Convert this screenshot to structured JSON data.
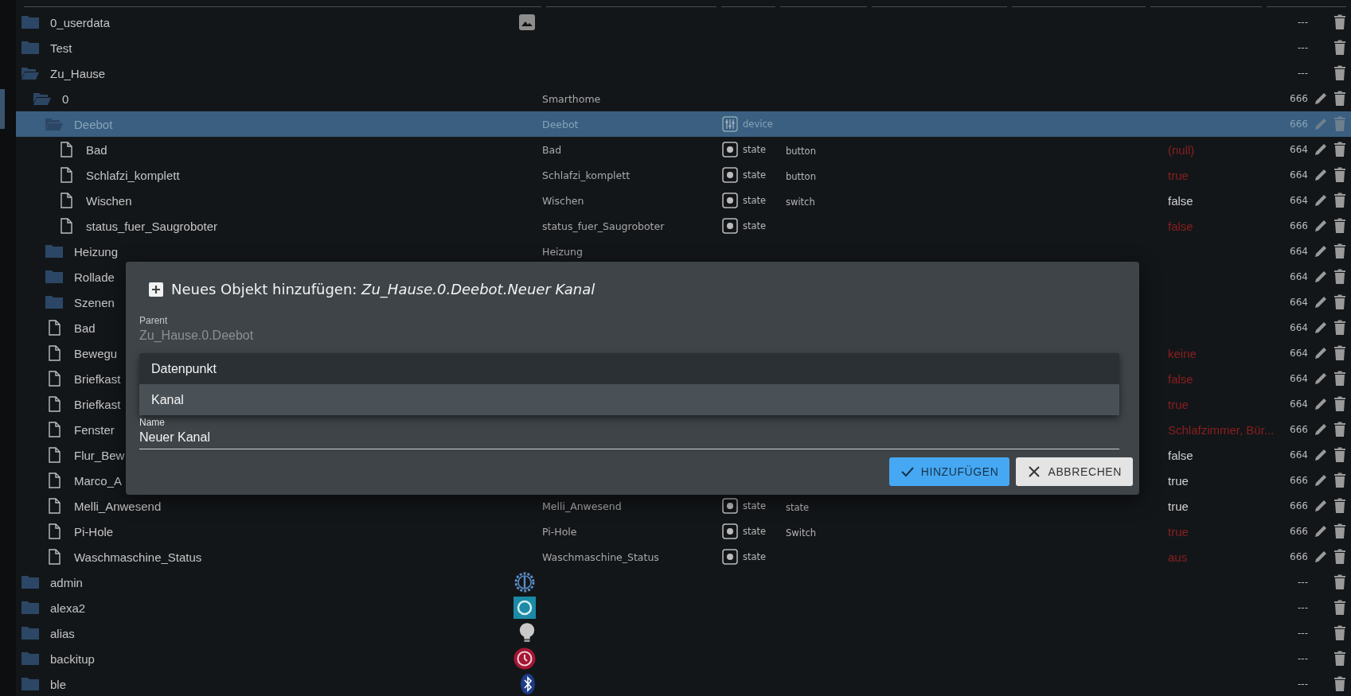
{
  "rows": [
    {
      "name": "0_userdata",
      "kind": "folder",
      "expanded": false,
      "selected": false,
      "adapter_icon": {
        "kind": "image"
      },
      "acl": "---",
      "editable": false
    },
    {
      "name": "Test",
      "kind": "folder",
      "expanded": false,
      "selected": false,
      "acl": "---",
      "editable": false
    },
    {
      "name": "Zu_Hause",
      "kind": "folder",
      "expanded": true,
      "selected": false,
      "acl": "---",
      "editable": false,
      "children": [
        {
          "name": "0",
          "kind": "folder",
          "expanded": true,
          "selected": false,
          "title": "Smarthome",
          "acl": "666",
          "editable": true,
          "children": [
            {
              "name": "Deebot",
              "kind": "folder",
              "expanded": true,
              "selected": true,
              "title": "Deebot",
              "type": {
                "kind": "device",
                "label": "device"
              },
              "acl": "666",
              "editable": true,
              "children": [
                {
                  "name": "Bad",
                  "kind": "file",
                  "selected": false,
                  "title": "Bad",
                  "type": {
                    "kind": "state",
                    "label": "state"
                  },
                  "role": "button",
                  "value": {
                    "text": "(null)",
                    "color": "#8b1f1f"
                  },
                  "acl": "664",
                  "editable": true
                },
                {
                  "name": "Schlafzi_komplett",
                  "kind": "file",
                  "selected": false,
                  "title": "Schlafzi_komplett",
                  "type": {
                    "kind": "state",
                    "label": "state"
                  },
                  "role": "button",
                  "value": {
                    "text": "true",
                    "color": "#8b1f1f"
                  },
                  "acl": "664",
                  "editable": true
                },
                {
                  "name": "Wischen",
                  "kind": "file",
                  "selected": false,
                  "title": "Wischen",
                  "type": {
                    "kind": "state",
                    "label": "state"
                  },
                  "role": "switch",
                  "value": {
                    "text": "false",
                    "color": "#cfcfcf"
                  },
                  "acl": "664",
                  "editable": true
                },
                {
                  "name": "status_fuer_Saugroboter",
                  "kind": "file",
                  "selected": false,
                  "title": "status_fuer_Saugroboter",
                  "type": {
                    "kind": "state",
                    "label": "state"
                  },
                  "value": {
                    "text": "false",
                    "color": "#8b1f1f"
                  },
                  "acl": "666",
                  "editable": true
                }
              ]
            },
            {
              "name": "Heizung",
              "kind": "folder",
              "expanded": false,
              "selected": false,
              "title": "Heizung",
              "acl": "664",
              "editable": true
            },
            {
              "name": "Rollade",
              "kind": "folder",
              "expanded": false,
              "selected": false,
              "acl": "664",
              "editable": true
            },
            {
              "name": "Szenen",
              "kind": "folder",
              "expanded": false,
              "selected": false,
              "acl": "664",
              "editable": true
            },
            {
              "name": "Bad",
              "kind": "file",
              "selected": false,
              "acl": "664",
              "editable": true
            },
            {
              "name": "Bewegu",
              "kind": "file",
              "selected": false,
              "value": {
                "text": "keine",
                "color": "#8b1f1f"
              },
              "acl": "664",
              "editable": true
            },
            {
              "name": "Briefkast",
              "kind": "file",
              "selected": false,
              "value": {
                "text": "false",
                "color": "#8b1f1f"
              },
              "acl": "664",
              "editable": true
            },
            {
              "name": "Briefkast",
              "kind": "file",
              "selected": false,
              "value": {
                "text": "true",
                "color": "#8b1f1f"
              },
              "acl": "664",
              "editable": true
            },
            {
              "name": "Fenster",
              "kind": "file",
              "selected": false,
              "value": {
                "text": "Schlafzimmer, Bür...",
                "color": "#8b1f1f"
              },
              "acl": "666",
              "editable": true
            },
            {
              "name": "Flur_Bew",
              "kind": "file",
              "selected": false,
              "value": {
                "text": "false",
                "color": "#cfcfcf"
              },
              "acl": "664",
              "editable": true
            },
            {
              "name": "Marco_A",
              "kind": "file",
              "selected": false,
              "value": {
                "text": "true",
                "color": "#cfcfcf"
              },
              "acl": "666",
              "editable": true
            },
            {
              "name": "Melli_Anwesend",
              "kind": "file",
              "selected": false,
              "title": "Melli_Anwesend",
              "type": {
                "kind": "state",
                "label": "state"
              },
              "role": "state",
              "value": {
                "text": "true",
                "color": "#cfcfcf"
              },
              "acl": "666",
              "editable": true
            },
            {
              "name": "Pi-Hole",
              "kind": "file",
              "selected": false,
              "title": "Pi-Hole",
              "type": {
                "kind": "state",
                "label": "state"
              },
              "role": "Switch",
              "value": {
                "text": "true",
                "color": "#8b1f1f"
              },
              "acl": "666",
              "editable": true
            },
            {
              "name": "Waschmaschine_Status",
              "kind": "file",
              "selected": false,
              "title": "Waschmaschine_Status",
              "type": {
                "kind": "state",
                "label": "state"
              },
              "value": {
                "text": "aus",
                "color": "#8b1f1f"
              },
              "acl": "666",
              "editable": true
            }
          ]
        }
      ]
    },
    {
      "name": "admin",
      "kind": "folder",
      "expanded": false,
      "selected": false,
      "adapter_icon": {
        "kind": "gear"
      },
      "acl": "---",
      "editable": false
    },
    {
      "name": "alexa2",
      "kind": "folder",
      "expanded": false,
      "selected": false,
      "adapter_icon": {
        "kind": "ring"
      },
      "acl": "---",
      "editable": false
    },
    {
      "name": "alias",
      "kind": "folder",
      "expanded": false,
      "selected": false,
      "adapter_icon": {
        "kind": "bulb"
      },
      "acl": "---",
      "editable": false
    },
    {
      "name": "backitup",
      "kind": "folder",
      "expanded": false,
      "selected": false,
      "adapter_icon": {
        "kind": "clock"
      },
      "acl": "---",
      "editable": false
    },
    {
      "name": "ble",
      "kind": "folder",
      "expanded": false,
      "selected": false,
      "adapter_icon": {
        "kind": "bluetooth"
      },
      "acl": "---",
      "editable": false
    }
  ],
  "dialog": {
    "title": "Neues Objekt hinzufügen: *Zu_Hause.0.Deebot.Neuer Kanal*",
    "parent": {
      "label": "Parent",
      "value": "Zu_Hause.0.Deebot"
    },
    "options": [
      {
        "label": "Datenpunkt",
        "selected": false
      },
      {
        "label": "Kanal",
        "selected": true
      }
    ],
    "name": {
      "label": "Name",
      "value": "Neuer Kanal"
    },
    "buttons": [
      {
        "kind": "primary",
        "label": "HINZUFÜGEN"
      },
      {
        "kind": "secondary",
        "label": "ABBRECHEN"
      }
    ]
  }
}
